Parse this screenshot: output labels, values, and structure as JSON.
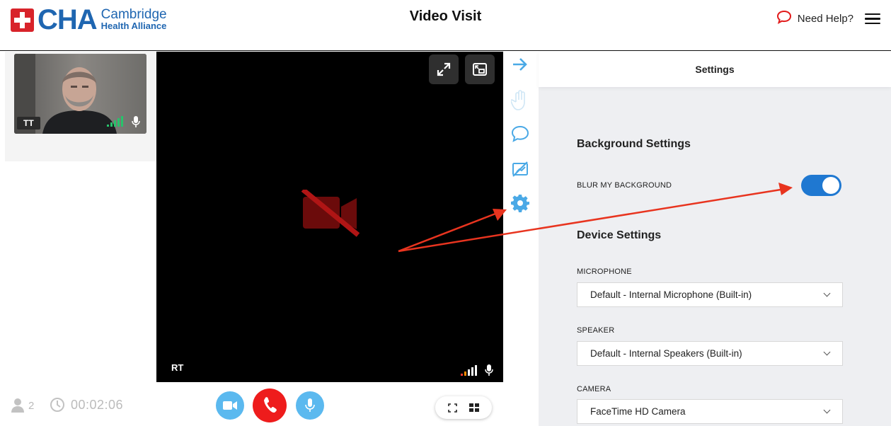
{
  "header": {
    "logo_abbr": "CHA",
    "logo_line1": "Cambridge",
    "logo_line2": "Health Alliance",
    "title": "Video Visit",
    "help_label": "Need Help?"
  },
  "self_view": {
    "initials": "TT"
  },
  "stage": {
    "initials": "RT"
  },
  "bottom_bar": {
    "participant_count": "2",
    "elapsed": "00:02:06"
  },
  "settings": {
    "title": "Settings",
    "background_heading": "Background Settings",
    "blur_label": "BLUR MY BACKGROUND",
    "blur_enabled": true,
    "device_heading": "Device Settings",
    "microphone_label": "MICROPHONE",
    "microphone_value": "Default - Internal Microphone (Built-in)",
    "speaker_label": "SPEAKER",
    "speaker_value": "Default - Internal Speakers (Built-in)",
    "camera_label": "CAMERA",
    "camera_value": "FaceTime HD Camera"
  },
  "colors": {
    "brand_blue": "#1f66b1",
    "brand_red": "#d8232a",
    "accent_blue": "#5bb9ef",
    "toggle_blue": "#1f78d1",
    "end_call_red": "#ee1c1c",
    "annotation_red": "#e8341f"
  },
  "icons": {
    "toolbar": [
      "arrow-right-icon",
      "raise-hand-icon",
      "chat-icon",
      "screen-share-off-icon",
      "gear-icon"
    ],
    "stage": [
      "expand-icon",
      "picture-in-picture-icon",
      "camera-off-icon",
      "signal-icon",
      "microphone-icon"
    ],
    "bottom": [
      "person-icon",
      "clock-icon",
      "video-camera-icon",
      "phone-icon",
      "microphone-icon",
      "fullscreen-icon",
      "grid-icon"
    ]
  }
}
